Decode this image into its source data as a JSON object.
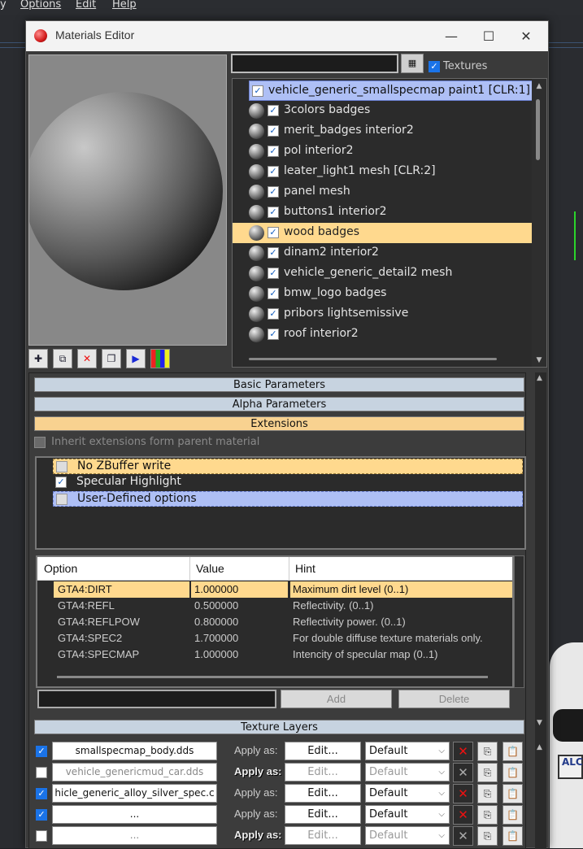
{
  "app_menu": {
    "partial": "y",
    "options": "Options",
    "edit": "Edit",
    "help": "Help"
  },
  "window": {
    "title": "Materials Editor",
    "minimize": "—",
    "maximize": "☐",
    "close": "✕"
  },
  "toolbar": {
    "filter_value": "",
    "filter_btn": "▦",
    "textures_label": "Textures",
    "textures_checked": true
  },
  "materials": [
    {
      "label": "vehicle_generic_smallspecmap paint1 [CLR:1]",
      "checked": true,
      "state": "selected-blue"
    },
    {
      "label": "3colors badges",
      "checked": true
    },
    {
      "label": "merit_badges interior2",
      "checked": true
    },
    {
      "label": "pol interior2",
      "checked": true
    },
    {
      "label": "leater_light1 mesh [CLR:2]",
      "checked": true
    },
    {
      "label": "panel mesh",
      "checked": true
    },
    {
      "label": "buttons1 interior2",
      "checked": true
    },
    {
      "label": "wood badges",
      "checked": true,
      "state": "highlighted"
    },
    {
      "label": "dinam2 interior2",
      "checked": true
    },
    {
      "label": "vehicle_generic_detail2 mesh",
      "checked": true
    },
    {
      "label": "bmw_logo badges",
      "checked": true
    },
    {
      "label": "pribors lightsemissive",
      "checked": true
    },
    {
      "label": "roof interior2",
      "checked": true
    }
  ],
  "rollouts": {
    "basic": "Basic Parameters",
    "alpha": "Alpha Parameters",
    "extensions": "Extensions",
    "texture_layers": "Texture Layers"
  },
  "extensions": {
    "inherit_label": "Inherit extensions form parent material",
    "items": [
      {
        "label": "No ZBuffer write",
        "checked": false
      },
      {
        "label": "Specular Highlight",
        "checked": true
      },
      {
        "label": "User-Defined options",
        "checked": false
      }
    ]
  },
  "options_table": {
    "headers": {
      "option": "Option",
      "value": "Value",
      "hint": "Hint"
    },
    "rows": [
      {
        "option": "GTA4:DIRT",
        "value": "1.000000",
        "hint": "Maximum dirt level (0..1)",
        "selected": true
      },
      {
        "option": "GTA4:REFL",
        "value": "0.500000",
        "hint": "Reflectivity. (0..1)"
      },
      {
        "option": "GTA4:REFLPOW",
        "value": "0.800000",
        "hint": "Reflectivity power. (0..1)"
      },
      {
        "option": "GTA4:SPEC2",
        "value": "1.700000",
        "hint": "For double diffuse texture materials only."
      },
      {
        "option": "GTA4:SPECMAP",
        "value": "1.000000",
        "hint": "Intencity of specular map (0..1)"
      }
    ],
    "add_label": "Add",
    "delete_label": "Delete"
  },
  "texture_layers": [
    {
      "name": "smallspecmap_body.dds",
      "checked": true,
      "apply_as": "Apply as:",
      "edit": "Edit...",
      "mode": "Default",
      "dim": false
    },
    {
      "name": "vehicle_genericmud_car.dds",
      "checked": false,
      "apply_as": "Apply as:",
      "edit": "Edit...",
      "mode": "Default",
      "dim": true
    },
    {
      "name": "hicle_generic_alloy_silver_spec.c",
      "checked": true,
      "apply_as": "Apply as:",
      "edit": "Edit...",
      "mode": "Default",
      "dim": false
    },
    {
      "name": "...",
      "checked": true,
      "apply_as": "Apply as:",
      "edit": "Edit...",
      "mode": "Default",
      "dim": false
    },
    {
      "name": "...",
      "checked": false,
      "apply_as": "Apply as:",
      "edit": "Edit...",
      "mode": "Default",
      "dim": true
    }
  ],
  "background": {
    "plate_text": "ALC"
  }
}
